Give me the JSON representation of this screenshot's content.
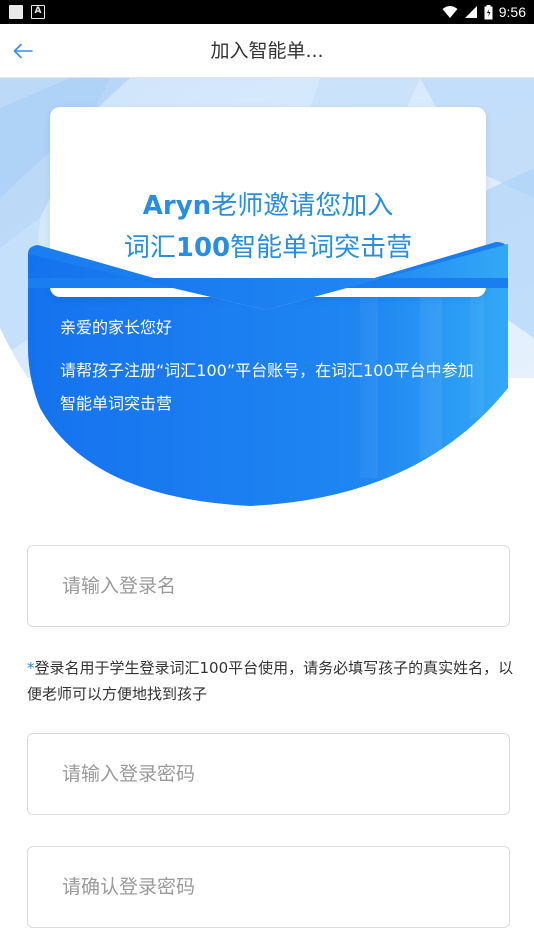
{
  "status_bar": {
    "time": "9:56",
    "notif_icon": "A"
  },
  "app_bar": {
    "title": "加入智能单..."
  },
  "hero": {
    "invite_name": "Aryn",
    "invite_rest": "老师邀请您加入",
    "camp_prefix": "词汇",
    "camp_number": "100",
    "camp_suffix": "智能单词突击营",
    "greeting": "亲爱的家长您好",
    "instructions": "请帮孩子注册“词汇100”平台账号，在词汇100平台中参加智能单词突击营"
  },
  "form": {
    "login_placeholder": "请输入登录名",
    "note_star": "*",
    "note_text": "登录名用于学生登录词汇100平台使用，请务必填写孩子的真实姓名，以便老师可以方便地找到孩子",
    "password_placeholder": "请输入登录密码",
    "confirm_placeholder": "请确认登录密码"
  },
  "colors": {
    "accent": "#2a8ee0",
    "hero_blue": "#1976f0"
  }
}
